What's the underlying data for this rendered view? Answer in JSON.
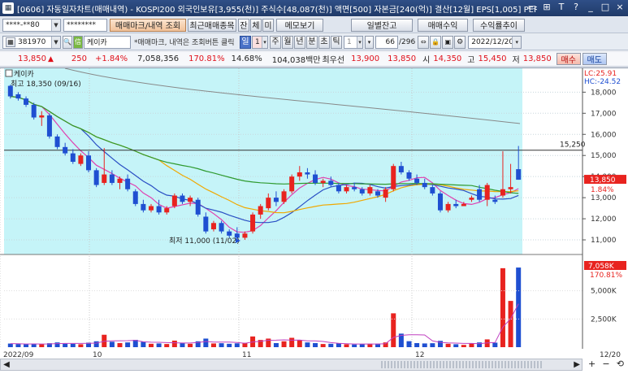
{
  "window": {
    "title": "[0606] 자동일자차트(매매내역) - KOSPI200 외국인보유[3,955(천)] 주식수[48,087(천)] 액면[500] 자본금[240(억)] 결산[12월] EPS[1,005] PER[13.7]",
    "controls": [
      "▭",
      "⊞",
      "T",
      "?",
      "_",
      "□",
      "×"
    ]
  },
  "toolbar1": {
    "account": "****-**80",
    "password": "********",
    "buttons": [
      "매매마크/내역 조회",
      "최근매매종목",
      "잔",
      "체",
      "미",
      "메모보기"
    ],
    "right_buttons": [
      "일별잔고",
      "매매수익",
      "수익률추이"
    ]
  },
  "toolbar2": {
    "code": "381970",
    "stock_name": "케이카",
    "hint": "*매매마크, 내역은 조회버튼 클릭",
    "periods": [
      "일",
      "주",
      "월",
      "년",
      "분",
      "초",
      "틱"
    ],
    "period_num": "1",
    "period_unit": "1",
    "count": "66",
    "total": "/296",
    "date": "2022/12/20"
  },
  "quote": {
    "price": "13,850",
    "arrow": "▲",
    "change": "250",
    "rate": "+1.84%",
    "volume": "7,058,356",
    "vol_ratio": "170.81%",
    "turnover": "14.68%",
    "amount": "104,038백만",
    "best_label": "최우선",
    "ask": "13,900",
    "bid": "13,850",
    "open_label": "시",
    "open": "14,350",
    "high_label": "고",
    "high": "15,450",
    "low_label": "저",
    "low": "13,850",
    "buy": "매수",
    "sell": "매도"
  },
  "chart_data": {
    "type": "candlestick",
    "stock_label": "케이카",
    "high_note": "최고 18,350 (09/16)",
    "low_note": "최저 11,000 (11/02)",
    "lc": "LC:25.91",
    "hc": "HC:-24.52",
    "hline_value": "15,250",
    "price_tag": "13,850",
    "change_tag": "1.84%",
    "y_ticks": [
      "18,000",
      "17,000",
      "16,000",
      "15,000",
      "14,000",
      "13,000",
      "12,000",
      "11,000"
    ],
    "ylim": [
      10500,
      18900
    ],
    "vol_ticks": [
      "5,000K",
      "2,500K"
    ],
    "vol_tag": "7,058K",
    "vol_ratio_tag": "170.81%",
    "x_labels": [
      "2022/09",
      "10",
      "11",
      "12"
    ],
    "date_label": "12/20",
    "candles": [
      [
        18300,
        18350,
        17700,
        17800
      ],
      [
        17900,
        18000,
        17600,
        17700
      ],
      [
        17700,
        17800,
        17300,
        17400
      ],
      [
        17400,
        17500,
        16700,
        16800
      ],
      [
        16800,
        17100,
        16400,
        16900
      ],
      [
        16900,
        17000,
        15800,
        15900
      ],
      [
        15900,
        16000,
        15300,
        15400
      ],
      [
        15400,
        15600,
        15000,
        15100
      ],
      [
        15100,
        15300,
        14600,
        14700
      ],
      [
        14600,
        15100,
        14500,
        15000
      ],
      [
        15000,
        15200,
        14200,
        14300
      ],
      [
        14300,
        14400,
        13500,
        13600
      ],
      [
        13700,
        15350,
        13600,
        14100
      ],
      [
        14100,
        14300,
        13600,
        13700
      ],
      [
        13700,
        14000,
        13400,
        13900
      ],
      [
        13900,
        14100,
        13300,
        13400
      ],
      [
        13300,
        13400,
        12600,
        12700
      ],
      [
        12700,
        12900,
        12300,
        12400
      ],
      [
        12400,
        12700,
        12300,
        12600
      ],
      [
        12600,
        12900,
        12200,
        12300
      ],
      [
        12300,
        12600,
        12200,
        12500
      ],
      [
        12600,
        13200,
        12500,
        13100
      ],
      [
        13100,
        13200,
        12700,
        12800
      ],
      [
        12800,
        13100,
        12600,
        13000
      ],
      [
        12900,
        13000,
        12100,
        12200
      ],
      [
        12100,
        12300,
        11300,
        11400
      ],
      [
        11500,
        11900,
        11400,
        11800
      ],
      [
        11800,
        11900,
        11300,
        11400
      ],
      [
        11400,
        11500,
        11100,
        11200
      ],
      [
        11300,
        11600,
        11000,
        11100
      ],
      [
        11100,
        11400,
        11000,
        11300
      ],
      [
        11400,
        12300,
        11300,
        12200
      ],
      [
        12200,
        12700,
        12000,
        12600
      ],
      [
        12500,
        13200,
        12400,
        13000
      ],
      [
        13000,
        13300,
        12600,
        12800
      ],
      [
        12800,
        13400,
        12700,
        13300
      ],
      [
        13300,
        14100,
        13200,
        14000
      ],
      [
        14000,
        14500,
        13800,
        14200
      ],
      [
        14200,
        14400,
        13900,
        14100
      ],
      [
        14100,
        14300,
        13600,
        13700
      ],
      [
        13700,
        13900,
        13500,
        13800
      ],
      [
        13800,
        14000,
        13500,
        13600
      ],
      [
        13600,
        13700,
        13200,
        13300
      ],
      [
        13300,
        13600,
        13200,
        13500
      ],
      [
        13500,
        13700,
        13300,
        13400
      ],
      [
        13400,
        13500,
        13100,
        13200
      ],
      [
        13200,
        13600,
        13100,
        13500
      ],
      [
        13300,
        13400,
        13000,
        13100
      ],
      [
        13000,
        13500,
        12800,
        13400
      ],
      [
        13400,
        14600,
        13300,
        14500
      ],
      [
        14500,
        14700,
        14100,
        14200
      ],
      [
        14200,
        14300,
        13800,
        13900
      ],
      [
        13900,
        14100,
        13600,
        13700
      ],
      [
        13700,
        13900,
        13400,
        13500
      ],
      [
        13500,
        13600,
        13100,
        13200
      ],
      [
        13200,
        13300,
        12300,
        12400
      ],
      [
        12400,
        12800,
        12300,
        12700
      ],
      [
        12700,
        12900,
        12500,
        12600
      ],
      [
        12600,
        12800,
        12600,
        12700
      ],
      [
        12900,
        13100,
        12800,
        13000
      ],
      [
        13400,
        13600,
        12800,
        12900
      ],
      [
        12900,
        13700,
        12600,
        13600
      ],
      [
        12900,
        13100,
        12700,
        12800
      ],
      [
        13100,
        15200,
        13000,
        13400
      ],
      [
        13400,
        14600,
        13200,
        13500
      ],
      [
        14350,
        15450,
        13850,
        13850
      ]
    ],
    "volumes": [
      320,
      280,
      250,
      300,
      260,
      350,
      420,
      310,
      300,
      260,
      400,
      520,
      1100,
      480,
      360,
      420,
      650,
      470,
      300,
      330,
      280,
      580,
      360,
      300,
      520,
      760,
      330,
      350,
      300,
      340,
      380,
      950,
      640,
      760,
      360,
      520,
      830,
      650,
      420,
      360,
      280,
      300,
      330,
      260,
      240,
      280,
      300,
      310,
      420,
      3000,
      1200,
      530,
      360,
      330,
      350,
      560,
      300,
      260,
      200,
      340,
      420,
      690,
      400,
      7000,
      4100,
      7058
    ],
    "vol_max": 8000
  }
}
